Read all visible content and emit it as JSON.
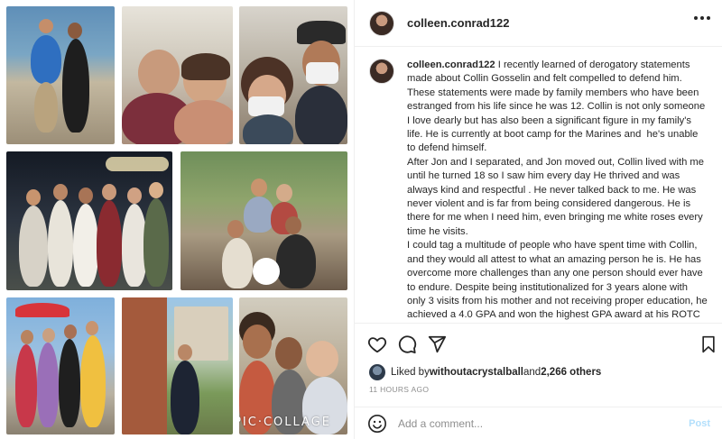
{
  "post": {
    "username": "colleen.conrad122",
    "collage_watermark": "PIC·COLLAGE",
    "caption": {
      "username": "colleen.conrad122",
      "text": " I recently learned of derogatory statements made about Collin Gosselin and felt compelled to defend him. These statements were made by family members who have been estranged from his life since he was 12. Collin is not only someone I love dearly but has also been a significant figure in my family's life. He is currently at boot camp for the Marines and  he's unable to defend himself.\nAfter Jon and I separated, and Jon moved out, Collin lived with me until he turned 18 so I saw him every day He thrived and was always kind and respectful . He never talked back to me. He was never violent and is far from being considered dangerous. He is there for me when I need him, even bringing me white roses every time he visits.\nI could tag a multitude of people who have spent time with Collin, and they would all attest to what an amazing person he is. He has overcome more challenges than any one person should ever have to endure. Despite being institutionalized for 3 years alone with only 3 visits from his mother and not receiving proper education, he achieved a 4.0 GPA and won the highest GPA award at his ROTC boot camp. I am incredibly proud of him."
    },
    "likes": {
      "prefix": "Liked by ",
      "user": "withoutacrystalball",
      "middle": " and ",
      "count": "2,266 others"
    },
    "time_ago": "11 HOURS AGO",
    "comment": {
      "placeholder": "Add a comment...",
      "post_label": "Post"
    }
  },
  "icons": {
    "more": "more-horizontal-icon",
    "like": "heart-icon",
    "comment": "comment-bubble-icon",
    "share": "paper-plane-icon",
    "save": "bookmark-icon",
    "emoji": "emoji-icon"
  },
  "colors": {
    "text": "#262626",
    "muted": "#8e8e8e",
    "post_button": "#b2dffc",
    "divider": "#efefef"
  }
}
